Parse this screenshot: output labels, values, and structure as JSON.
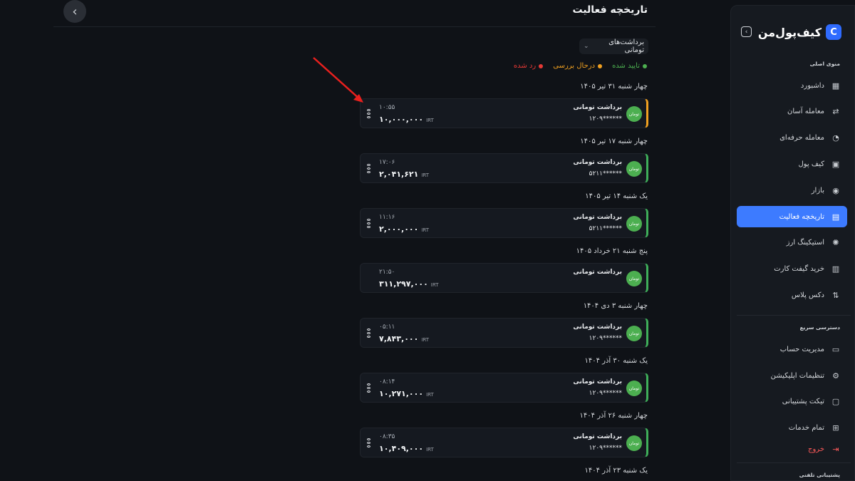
{
  "header": {
    "title": "تاریخچه فعالیت",
    "back_icon": "chevron-left-icon"
  },
  "filter": {
    "label": "برداشت‌های تومانی",
    "icon": "chevron-down-icon"
  },
  "legend": [
    {
      "label": "تایید شده",
      "color": "#4caf50"
    },
    {
      "label": "درحال بررسی",
      "color": "#f0a020"
    },
    {
      "label": "رد شده",
      "color": "#e53935"
    }
  ],
  "groups": [
    {
      "date": "چهار شنبه ۳۱ تیر ۱۴۰۵",
      "tx": {
        "title": "برداشت  تومانی",
        "account": "******۱۲۰۹",
        "time": "۱۰:۵۵",
        "amount": "۱۰,۰۰۰,۰۰۰",
        "currency": "IRT",
        "badge": "تومان",
        "status": "pending"
      }
    },
    {
      "date": "چهار شنبه ۱۷ تیر ۱۴۰۵",
      "tx": {
        "title": "برداشت  تومانی",
        "account": "******۵۲۱۱",
        "time": "۱۷:۰۶",
        "amount": "۲,۰۴۱,۶۲۱",
        "currency": "IRT",
        "badge": "تومان",
        "status": "approved"
      }
    },
    {
      "date": "یک شنبه ۱۴ تیر ۱۴۰۵",
      "tx": {
        "title": "برداشت  تومانی",
        "account": "******۵۲۱۱",
        "time": "۱۱:۱۶",
        "amount": "۲,۰۰۰,۰۰۰",
        "currency": "IRT",
        "badge": "تومان",
        "status": "approved"
      }
    },
    {
      "date": "پنج شنبه ۲۱ خرداد ۱۴۰۵",
      "tx": {
        "title": "برداشت  تومانی",
        "account": "",
        "time": "۲۱:۵۰",
        "amount": "۳۱۱,۲۹۷,۰۰۰",
        "currency": "IRT",
        "badge": "تومان",
        "status": "approved"
      }
    },
    {
      "date": "چهار شنبه ۳ دی ۱۴۰۴",
      "tx": {
        "title": "برداشت  تومانی",
        "account": "******۱۲۰۹",
        "time": "۰۵:۱۱",
        "amount": "۷,۸۴۳,۰۰۰",
        "currency": "IRT",
        "badge": "تومان",
        "status": "approved"
      }
    },
    {
      "date": "یک شنبه ۳۰ آذر ۱۴۰۴",
      "tx": {
        "title": "برداشت  تومانی",
        "account": "******۱۲۰۹",
        "time": "۰۸:۱۴",
        "amount": "۱۰,۲۷۱,۰۰۰",
        "currency": "IRT",
        "badge": "تومان",
        "status": "approved"
      }
    },
    {
      "date": "چهار شنبه ۲۶ آذر ۱۴۰۴",
      "tx": {
        "title": "برداشت  تومانی",
        "account": "******۱۲۰۹",
        "time": "۰۸:۳۵",
        "amount": "۱۰,۴۰۹,۰۰۰",
        "currency": "IRT",
        "badge": "تومان",
        "status": "approved"
      }
    },
    {
      "date": "یک شنبه ۲۳ آذر ۱۴۰۴",
      "tx": null
    }
  ],
  "sidebar": {
    "brand": "کیف‌پول‌من",
    "brand_logo": "C",
    "collapse_icon": "chevron-left-square-icon",
    "main_menu_title": "منوی اصلی",
    "main_menu": [
      {
        "label": "داشبورد",
        "icon": "grid-icon"
      },
      {
        "label": "معامله آسان",
        "icon": "swap-icon"
      },
      {
        "label": "معامله حرفه‌ای",
        "icon": "chart-icon"
      },
      {
        "label": "کیف پول",
        "icon": "wallet-icon"
      },
      {
        "label": "بازار",
        "icon": "coin-icon"
      },
      {
        "label": "تاریخچه فعالیت",
        "icon": "history-icon",
        "active": true
      },
      {
        "label": "استیکینگ ارز",
        "icon": "staking-icon"
      },
      {
        "label": "خرید گیفت کارت",
        "icon": "gift-icon"
      },
      {
        "label": "دکس پلاس",
        "icon": "dex-icon"
      }
    ],
    "quick_title": "دسترسی سریع",
    "quick_menu": [
      {
        "label": "مدیریت حساب",
        "icon": "user-card-icon"
      },
      {
        "label": "تنظیمات اپلیکیشن",
        "icon": "settings-icon"
      },
      {
        "label": "تیکت پشتیبانی",
        "icon": "ticket-icon"
      },
      {
        "label": "تمام خدمات",
        "icon": "apps-icon"
      }
    ],
    "logout": {
      "label": "خروج",
      "icon": "logout-icon"
    },
    "support_title": "پشتیبانی تلفنی"
  }
}
